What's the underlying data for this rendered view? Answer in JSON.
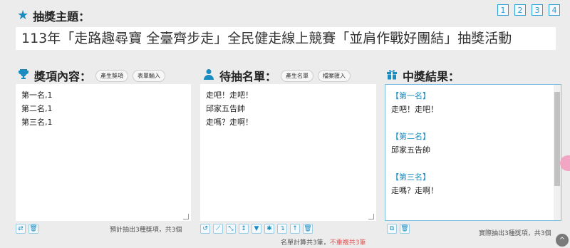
{
  "topic": {
    "label": "抽獎主題：",
    "value": "113年「走路趣尋寶 全臺齊步走」全民健走線上競賽「並肩作戰好團結」抽獎活動"
  },
  "pages": [
    "1",
    "2",
    "3",
    "4"
  ],
  "prizes": {
    "label": "獎項內容：",
    "buttons": [
      "產生獎項",
      "表單輸入"
    ],
    "lines": [
      "第一名,1",
      "第二名,1",
      "第三名,1"
    ],
    "status": "預計抽出3種獎項，共3個"
  },
  "candidates": {
    "label": "待抽名單：",
    "buttons": [
      "產生名單",
      "檔案匯入"
    ],
    "lines": [
      "走吧！走吧！",
      "邱家五告帥",
      "走嗎？走啊！"
    ],
    "status_prefix": "名單計算共3筆，",
    "status_red": "不重複共3筆"
  },
  "results": {
    "label": "中獎結果：",
    "entries": [
      {
        "title": "【第一名】",
        "name": "走吧！走吧！"
      },
      {
        "title": "【第二名】",
        "name": "邱家五告帥"
      },
      {
        "title": "【第三名】",
        "name": "走嗎？走啊！"
      }
    ],
    "status": "實際抽出3種獎項，共3個"
  },
  "icons": {
    "topic": "star-icon",
    "prizes": "trophy-icon",
    "candidates": "user-icon",
    "results": "gift-icon"
  },
  "colors": {
    "accent": "#1a8cbf",
    "warning": "#e05555"
  }
}
